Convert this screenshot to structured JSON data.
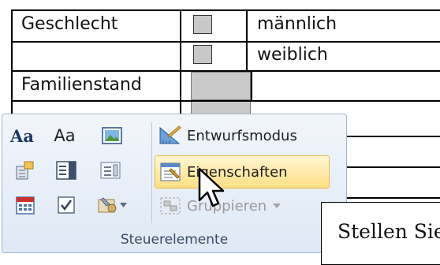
{
  "document_form": {
    "rows": [
      {
        "label": "Geschlecht",
        "option": "männlich"
      },
      {
        "label": "",
        "option": "weiblich"
      },
      {
        "label": "Familienstand",
        "option": ""
      }
    ]
  },
  "ribbon_group": {
    "buttons": {
      "design_mode": "Entwurfsmodus",
      "properties": "Eigenschaften",
      "group": "Gruppieren"
    },
    "rich_text_glyph": "Aa",
    "plain_text_glyph": "Aa",
    "group_label": "Steuerelemente"
  },
  "callout": {
    "text": "Stellen Sie"
  },
  "colors": {
    "highlight": "#ffdf86",
    "ribbon_bg": "#dfe8f5"
  }
}
